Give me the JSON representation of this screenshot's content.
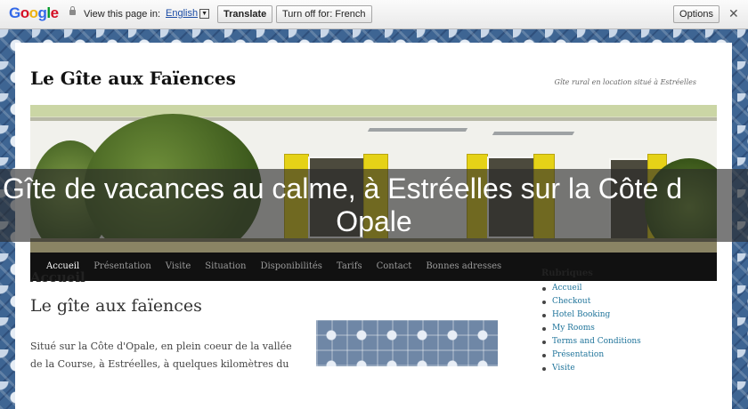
{
  "translate_bar": {
    "view_label": "View this page in:",
    "language": "English",
    "translate_label": "Translate",
    "turnoff_label": "Turn off for: French",
    "options_label": "Options"
  },
  "site": {
    "title": "Le Gîte aux Faïences",
    "tagline": "Gîte rural en location situé à Estréelles"
  },
  "overlay": {
    "line1": "Gîte de vacances au calme, à Estréelles sur la Côte d",
    "line2": "Opale"
  },
  "nav": {
    "items": [
      {
        "label": "Accueil",
        "active": true
      },
      {
        "label": "Présentation"
      },
      {
        "label": "Visite"
      },
      {
        "label": "Situation"
      },
      {
        "label": "Disponibilités"
      },
      {
        "label": "Tarifs"
      },
      {
        "label": "Contact"
      },
      {
        "label": "Bonnes adresses"
      }
    ]
  },
  "main": {
    "page_heading": "Accueil",
    "article_title": "Le gîte aux faïences",
    "paragraph": "Situé sur la Côte d'Opale, en plein coeur de la vallée de la Course, à Estréelles, à quelques kilomètres du"
  },
  "sidebar": {
    "heading": "Rubriques",
    "items": [
      "Accueil",
      "Checkout",
      "Hotel Booking",
      "My Rooms",
      "Terms and Conditions",
      "Présentation",
      "Visite"
    ]
  }
}
